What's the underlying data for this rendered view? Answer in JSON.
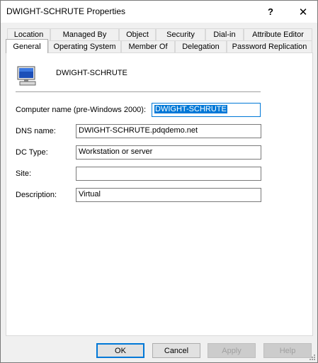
{
  "window": {
    "title": "DWIGHT-SCHRUTE Properties",
    "help_glyph": "?",
    "close_glyph": "✕"
  },
  "tabs_row1": [
    "Location",
    "Managed By",
    "Object",
    "Security",
    "Dial-in",
    "Attribute Editor"
  ],
  "tabs_row2": [
    "General",
    "Operating System",
    "Member Of",
    "Delegation",
    "Password Replication"
  ],
  "active_tab": "General",
  "general": {
    "computer_display_name": "DWIGHT-SCHRUTE",
    "fields": {
      "computer_name_label": "Computer name (pre-Windows 2000):",
      "computer_name_value": "DWIGHT-SCHRUTE",
      "dns_name_label": "DNS name:",
      "dns_name_value": "DWIGHT-SCHRUTE.pdqdemo.net",
      "dc_type_label": "DC Type:",
      "dc_type_value": "Workstation or server",
      "site_label": "Site:",
      "site_value": "",
      "description_label": "Description:",
      "description_value": "Virtual"
    }
  },
  "buttons": {
    "ok": "OK",
    "cancel": "Cancel",
    "apply": "Apply",
    "help": "Help"
  },
  "colors": {
    "accent": "#0078d7",
    "window_bg": "#f0f0f0"
  },
  "icons": {
    "computer": "computer-icon"
  }
}
